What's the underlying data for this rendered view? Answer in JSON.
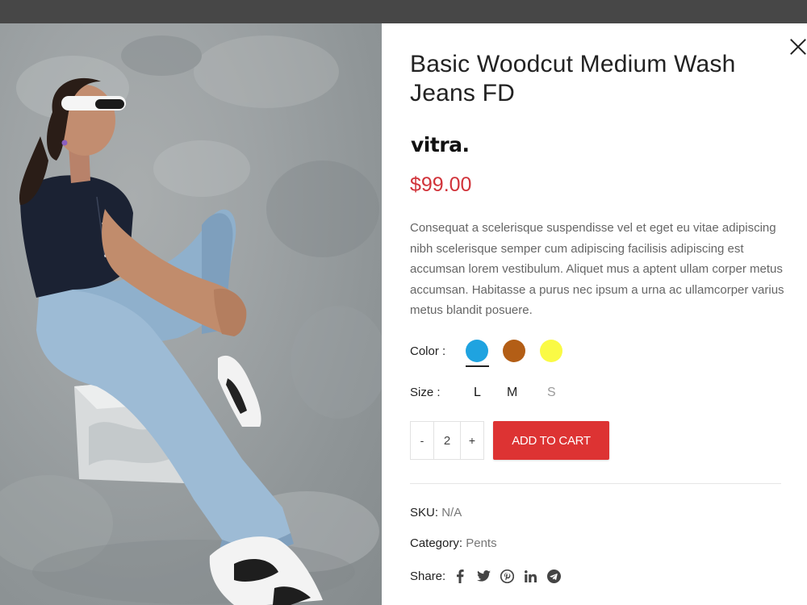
{
  "product": {
    "title": "Basic Woodcut Medium Wash Jeans FD",
    "brand": "vitra.",
    "price": "$99.00",
    "description": "Consequat a scelerisque suspendisse vel et eget eu vitae adipiscing nibh scelerisque semper cum adipiscing facilisis adipiscing est accumsan lorem vestibulum. Aliquet mus a aptent ullam corper metus accumsan. Habitasse a purus nec ipsum a urna ac ullamcorper varius metus blandit posuere."
  },
  "options": {
    "color_label": "Color :",
    "colors": [
      {
        "name": "blue",
        "hex": "#1fa3e0",
        "selected": true
      },
      {
        "name": "brown",
        "hex": "#b35e16",
        "selected": false
      },
      {
        "name": "yellow",
        "hex": "#fafa45",
        "selected": false
      }
    ],
    "size_label": "Size :",
    "sizes": [
      {
        "label": "L",
        "available": true
      },
      {
        "label": "M",
        "available": true
      },
      {
        "label": "S",
        "available": false
      }
    ]
  },
  "cart": {
    "minus": "-",
    "quantity": "2",
    "plus": "+",
    "add_label": "ADD TO CART"
  },
  "meta": {
    "sku_label": "SKU:",
    "sku_value": "N/A",
    "category_label": "Category:",
    "category_value": "Pents",
    "share_label": "Share:",
    "share_icons": [
      "facebook-icon",
      "twitter-icon",
      "pinterest-icon",
      "linkedin-icon",
      "telegram-icon"
    ]
  },
  "colors": {
    "accent": "#dd3333",
    "price": "#d1333a"
  }
}
